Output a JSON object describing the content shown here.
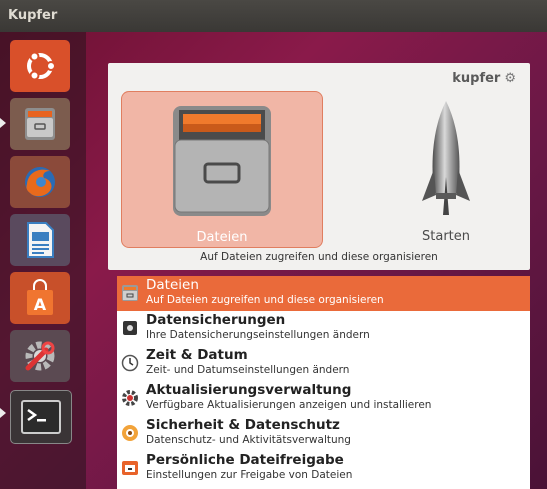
{
  "topbar": {
    "title": "Kupfer"
  },
  "launcher": {
    "items": [
      {
        "name": "ubuntu-dash-button",
        "icon": "ubuntu-logo-icon"
      },
      {
        "name": "files-button",
        "icon": "file-cabinet-icon"
      },
      {
        "name": "firefox-button",
        "icon": "firefox-icon"
      },
      {
        "name": "writer-button",
        "icon": "document-writer-icon"
      },
      {
        "name": "software-center-button",
        "icon": "shopping-bag-icon"
      },
      {
        "name": "system-settings-button",
        "icon": "wrench-gear-icon"
      },
      {
        "name": "terminal-button",
        "icon": "terminal-icon"
      }
    ]
  },
  "kupfer": {
    "brand": "kupfer",
    "brand_icon": "gear-icon",
    "object_label": "Dateien",
    "action_label": "Starten",
    "description": "Auf Dateien zugreifen und diese organisieren"
  },
  "results": [
    {
      "name": "Dateien",
      "desc": "Auf Dateien zugreifen und diese organisieren",
      "icon": "file-cabinet-icon",
      "selected": true
    },
    {
      "name": "Datensicherungen",
      "desc": "Ihre Datensicherungseinstellungen ändern",
      "icon": "backup-icon",
      "selected": false
    },
    {
      "name": "Zeit & Datum",
      "desc": "Zeit- und Datumseinstellungen ändern",
      "icon": "clock-icon",
      "selected": false
    },
    {
      "name": "Aktualisierungsverwaltung",
      "desc": "Verfügbare Aktualisierungen anzeigen und installieren",
      "icon": "update-gear-icon",
      "selected": false
    },
    {
      "name": "Sicherheit & Datenschutz",
      "desc": "Datenschutz- und Aktivitätsverwaltung",
      "icon": "privacy-icon",
      "selected": false
    },
    {
      "name": "Persönliche Dateifreigabe",
      "desc": "Einstellungen zur Freigabe von Dateien",
      "icon": "file-sharing-icon",
      "selected": false
    }
  ],
  "colors": {
    "accent": "#ea6a3a",
    "selection_tile": "#f1b6a6"
  }
}
